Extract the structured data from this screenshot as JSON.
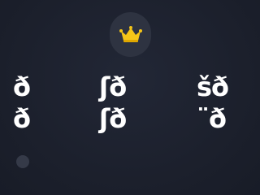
{
  "header": {
    "crown_icon": "crown-icon",
    "crown_color": "#f5c518"
  },
  "grid": {
    "row1": {
      "left": "ð",
      "center": "ʃð",
      "right": "šð"
    },
    "row2": {
      "left": "ð",
      "center": "ʃð",
      "right": "¨ð"
    }
  },
  "footer": {
    "dot_icon": "dot-icon"
  }
}
